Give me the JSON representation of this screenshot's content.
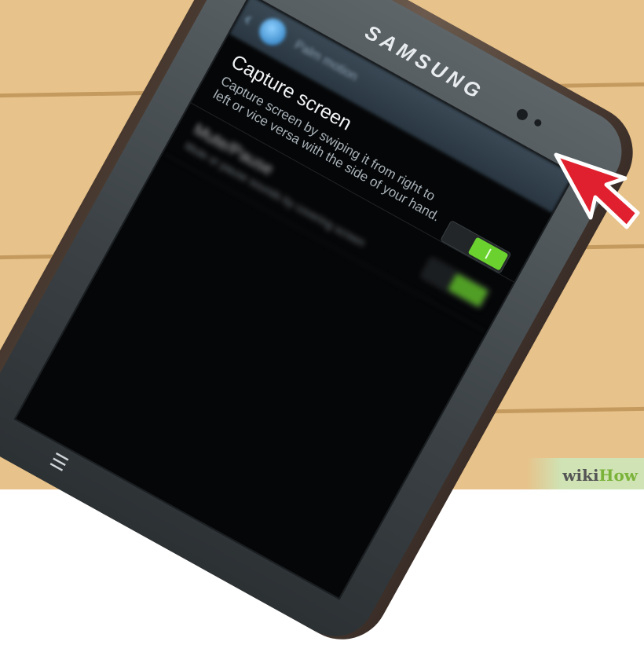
{
  "device": {
    "brand": "SAMSUNG"
  },
  "action_bar": {
    "title": "Palm motion"
  },
  "settings": [
    {
      "title": "Capture screen",
      "description": "Capture screen by swiping it from right to left or vice versa with the side of your hand.",
      "enabled": true,
      "highlighted": true
    },
    {
      "title": "Mute/Pause",
      "description": "Mute or pause sounds by covering screen",
      "enabled": true,
      "blurred": true
    }
  ],
  "watermark": {
    "part1": "wiki",
    "part2": "How"
  },
  "colors": {
    "toggle_on": "#6ad12f",
    "arrow": "#e0202e",
    "wikihow_green": "#7bb33a"
  }
}
